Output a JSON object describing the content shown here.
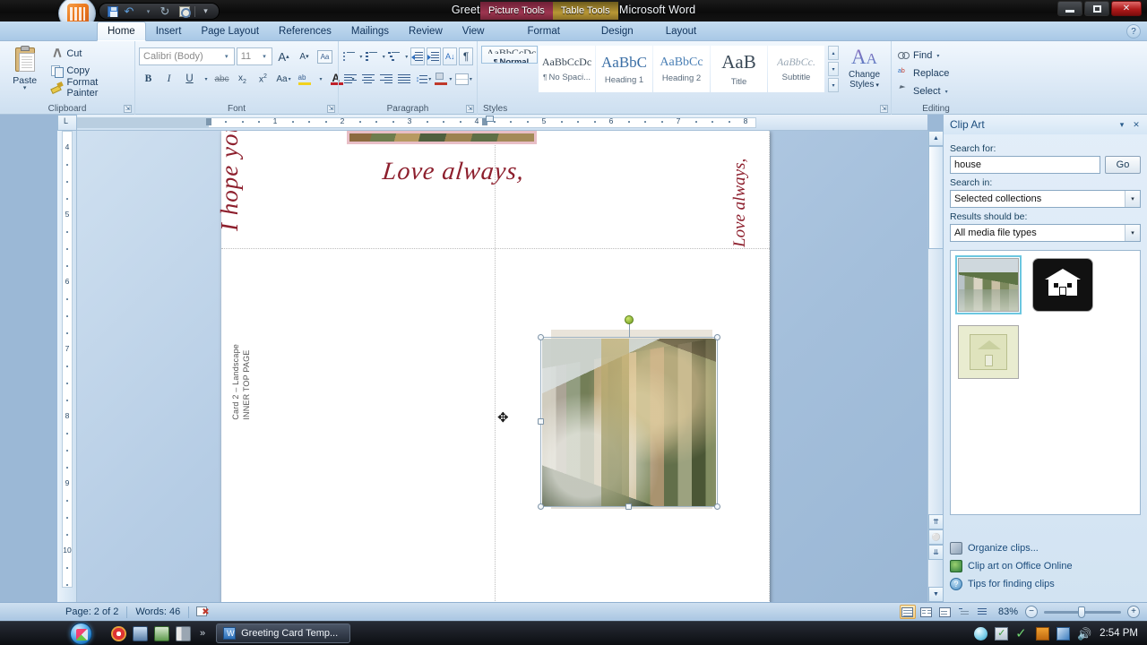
{
  "window": {
    "title": "Greeting Card Template 2.docx  -  Microsoft Word",
    "contextual_tabs": [
      {
        "label": "Picture Tools",
        "color": "#9d3550"
      },
      {
        "label": "Table Tools",
        "color": "#b89735"
      }
    ],
    "controls": {
      "minimize": "minimize",
      "maximize": "maximize",
      "close": "✕"
    }
  },
  "quick_access": {
    "items": [
      {
        "name": "save-icon",
        "label": "Save"
      },
      {
        "name": "undo-icon",
        "label": "Undo",
        "glyph": "↶"
      },
      {
        "name": "undo-dropdown-icon",
        "glyph": "▾"
      },
      {
        "name": "redo-icon",
        "label": "Redo",
        "glyph": "↻"
      },
      {
        "name": "print-preview-icon",
        "label": "Print Preview"
      },
      {
        "name": "customize-qat-icon",
        "glyph": "▾"
      }
    ]
  },
  "ribbon": {
    "tabs": [
      {
        "label": "Home",
        "active": true
      },
      {
        "label": "Insert",
        "active": false
      },
      {
        "label": "Page Layout",
        "active": false
      },
      {
        "label": "References",
        "active": false
      },
      {
        "label": "Mailings",
        "active": false
      },
      {
        "label": "Review",
        "active": false
      },
      {
        "label": "View",
        "active": false
      },
      {
        "label": "Format",
        "active": false
      },
      {
        "label": "Design",
        "active": false
      },
      {
        "label": "Layout",
        "active": false
      }
    ],
    "help_glyph": "?",
    "groups": {
      "clipboard": {
        "label": "Clipboard",
        "paste": "Paste",
        "paste_arrow": "▾",
        "commands": [
          "Cut",
          "Copy",
          "Format Painter"
        ]
      },
      "font": {
        "label": "Font",
        "font_name": "Calibri (Body)",
        "font_size": "11",
        "buttons": [
          "Grow Font",
          "Shrink Font",
          "Clear Formatting",
          "Bold",
          "Italic",
          "Underline",
          "Strikethrough",
          "Subscript",
          "Superscript",
          "Change Case",
          "Text Highlight Color",
          "Font Color"
        ],
        "glyphs": {
          "grow": "A",
          "shrink": "A",
          "clear": "Aa",
          "bold": "B",
          "italic": "I",
          "underline": "U",
          "strike": "abc",
          "sub": "x₂",
          "sup": "x²",
          "case": "Aa",
          "highlight": "ab",
          "color": "A"
        }
      },
      "paragraph": {
        "label": "Paragraph",
        "buttons": [
          "Bullets",
          "Numbering",
          "Multilevel List",
          "Decrease Indent",
          "Increase Indent",
          "Sort",
          "Show/Hide ¶",
          "Align Left",
          "Center",
          "Align Right",
          "Justify",
          "Line Spacing",
          "Shading",
          "Borders"
        ],
        "pilcrow": "¶",
        "sort": "↓"
      },
      "styles": {
        "label": "Styles",
        "items": [
          {
            "preview": "AaBbCcDc",
            "name": "Normal",
            "selected": true
          },
          {
            "preview": "AaBbCcDc",
            "name": "No Spaci...",
            "selected": false
          },
          {
            "preview": "AaBbC",
            "name": "Heading 1",
            "selected": false
          },
          {
            "preview": "AaBbCc",
            "name": "Heading 2",
            "selected": false
          },
          {
            "preview": "AaB",
            "name": "Title",
            "selected": false
          },
          {
            "preview": "AaBbCc.",
            "name": "Subtitle",
            "selected": false
          }
        ],
        "change_styles": "Change\nStyles",
        "change_styles_line1": "Change",
        "change_styles_line2": "Styles",
        "scroll_up": "▴",
        "scroll_down": "▾",
        "more": "▾"
      },
      "editing": {
        "label": "Editing",
        "commands": [
          "Find",
          "Replace",
          "Select"
        ],
        "arrow": "▾"
      }
    }
  },
  "rulers": {
    "tab_stop_label": "L",
    "horizontal_marks": [
      "1",
      "2",
      "3",
      "4",
      "5",
      "6",
      "7",
      "8"
    ],
    "vertical_marks": [
      "4",
      "5",
      "6",
      "7",
      "8",
      "9",
      "10"
    ]
  },
  "document": {
    "banner_alt": "decorative landscape photo strip",
    "love_always": "Love always,",
    "card_label_line1": "Card 2 – Landscape",
    "card_label_line2": "INNER TOP PAGE",
    "hope_text": "I hope you come home",
    "love_inner": "Love always,",
    "selected_image_alt": "landscape house clip art",
    "move_cursor_glyph": "✥"
  },
  "clip_art": {
    "title": "Clip Art",
    "menu_glyph": "▾",
    "close_glyph": "✕",
    "search_for_label": "Search for:",
    "search_value": "house",
    "search_placeholder": "Search for:",
    "go_label": "Go",
    "search_in_label": "Search in:",
    "search_in_value": "Selected collections",
    "results_label": "Results should be:",
    "results_value": "All media file types",
    "dropdown_glyph": "▾",
    "results": [
      {
        "name": "landscape-house-photo",
        "selected": true
      },
      {
        "name": "black-house-silhouette",
        "selected": false
      },
      {
        "name": "green-house-outline",
        "selected": false
      }
    ],
    "links": [
      {
        "label": "Organize clips...",
        "icon": "organize-clips-icon"
      },
      {
        "label": "Clip art on Office Online",
        "icon": "office-online-icon"
      },
      {
        "label": "Tips for finding clips",
        "icon": "tips-icon"
      }
    ]
  },
  "status_bar": {
    "page": "Page: 2 of 2",
    "words": "Words: 46",
    "proofing": "proofing-errors-icon",
    "views": [
      "Print Layout",
      "Full Screen Reading",
      "Web Layout",
      "Outline",
      "Draft"
    ],
    "zoom": "83%",
    "zoom_out": "−",
    "zoom_in": "+"
  },
  "taskbar": {
    "start": "start-orb",
    "quick_launch": [
      "chrome-icon",
      "show-desktop-icon",
      "network-icon",
      "reader-icon"
    ],
    "more_glyph": "»",
    "task": "Greeting Card Temp...",
    "tray": [
      "globe-icon",
      "update-icon",
      "security-icon",
      "battery-icon",
      "network-icon",
      "volume-icon"
    ],
    "clock": "2:54 PM"
  }
}
